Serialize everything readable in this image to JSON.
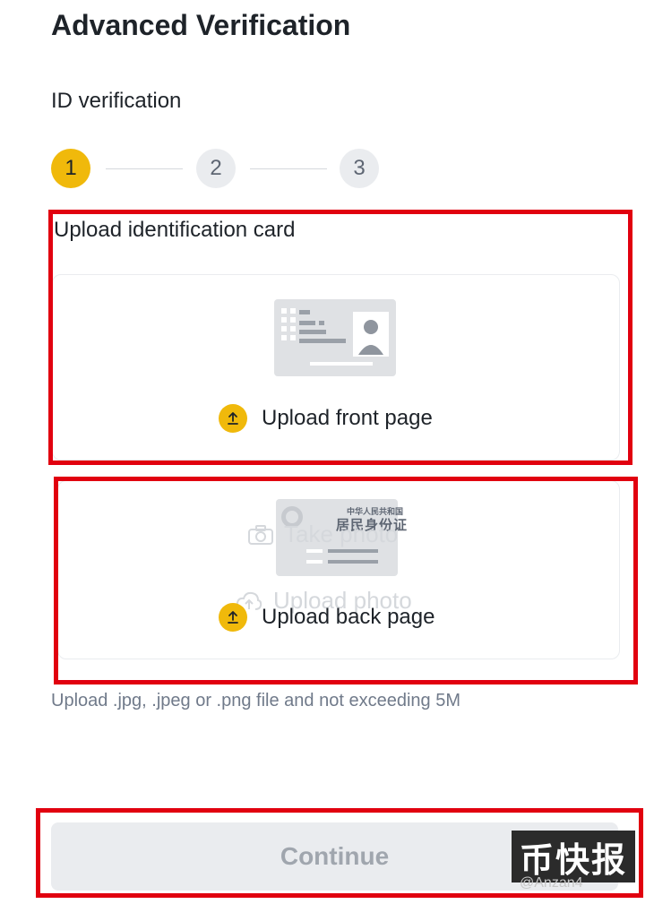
{
  "header": {
    "title": "Advanced Verification"
  },
  "section": {
    "subtitle": "ID verification"
  },
  "stepper": {
    "steps": [
      "1",
      "2",
      "3"
    ],
    "active_step": 1
  },
  "upload": {
    "label": "Upload identification card",
    "front_label": "Upload front page",
    "back_label": "Upload back page",
    "id_card_header_small": "中华人民共和国",
    "id_card_header_big": "居民身份证",
    "overlay_take_photo": "Take photo",
    "overlay_upload_photo": "Upload photo",
    "hint": "Upload .jpg, .jpeg or .png file and not exceeding 5M"
  },
  "footer": {
    "continue_label": "Continue"
  },
  "watermark": {
    "text": "币快报",
    "sub": "@Anzan4"
  },
  "colors": {
    "accent": "#f0b90b",
    "highlight_border": "#e1000f",
    "disabled_bg": "#eaecef",
    "disabled_text": "#a0a6ae"
  }
}
